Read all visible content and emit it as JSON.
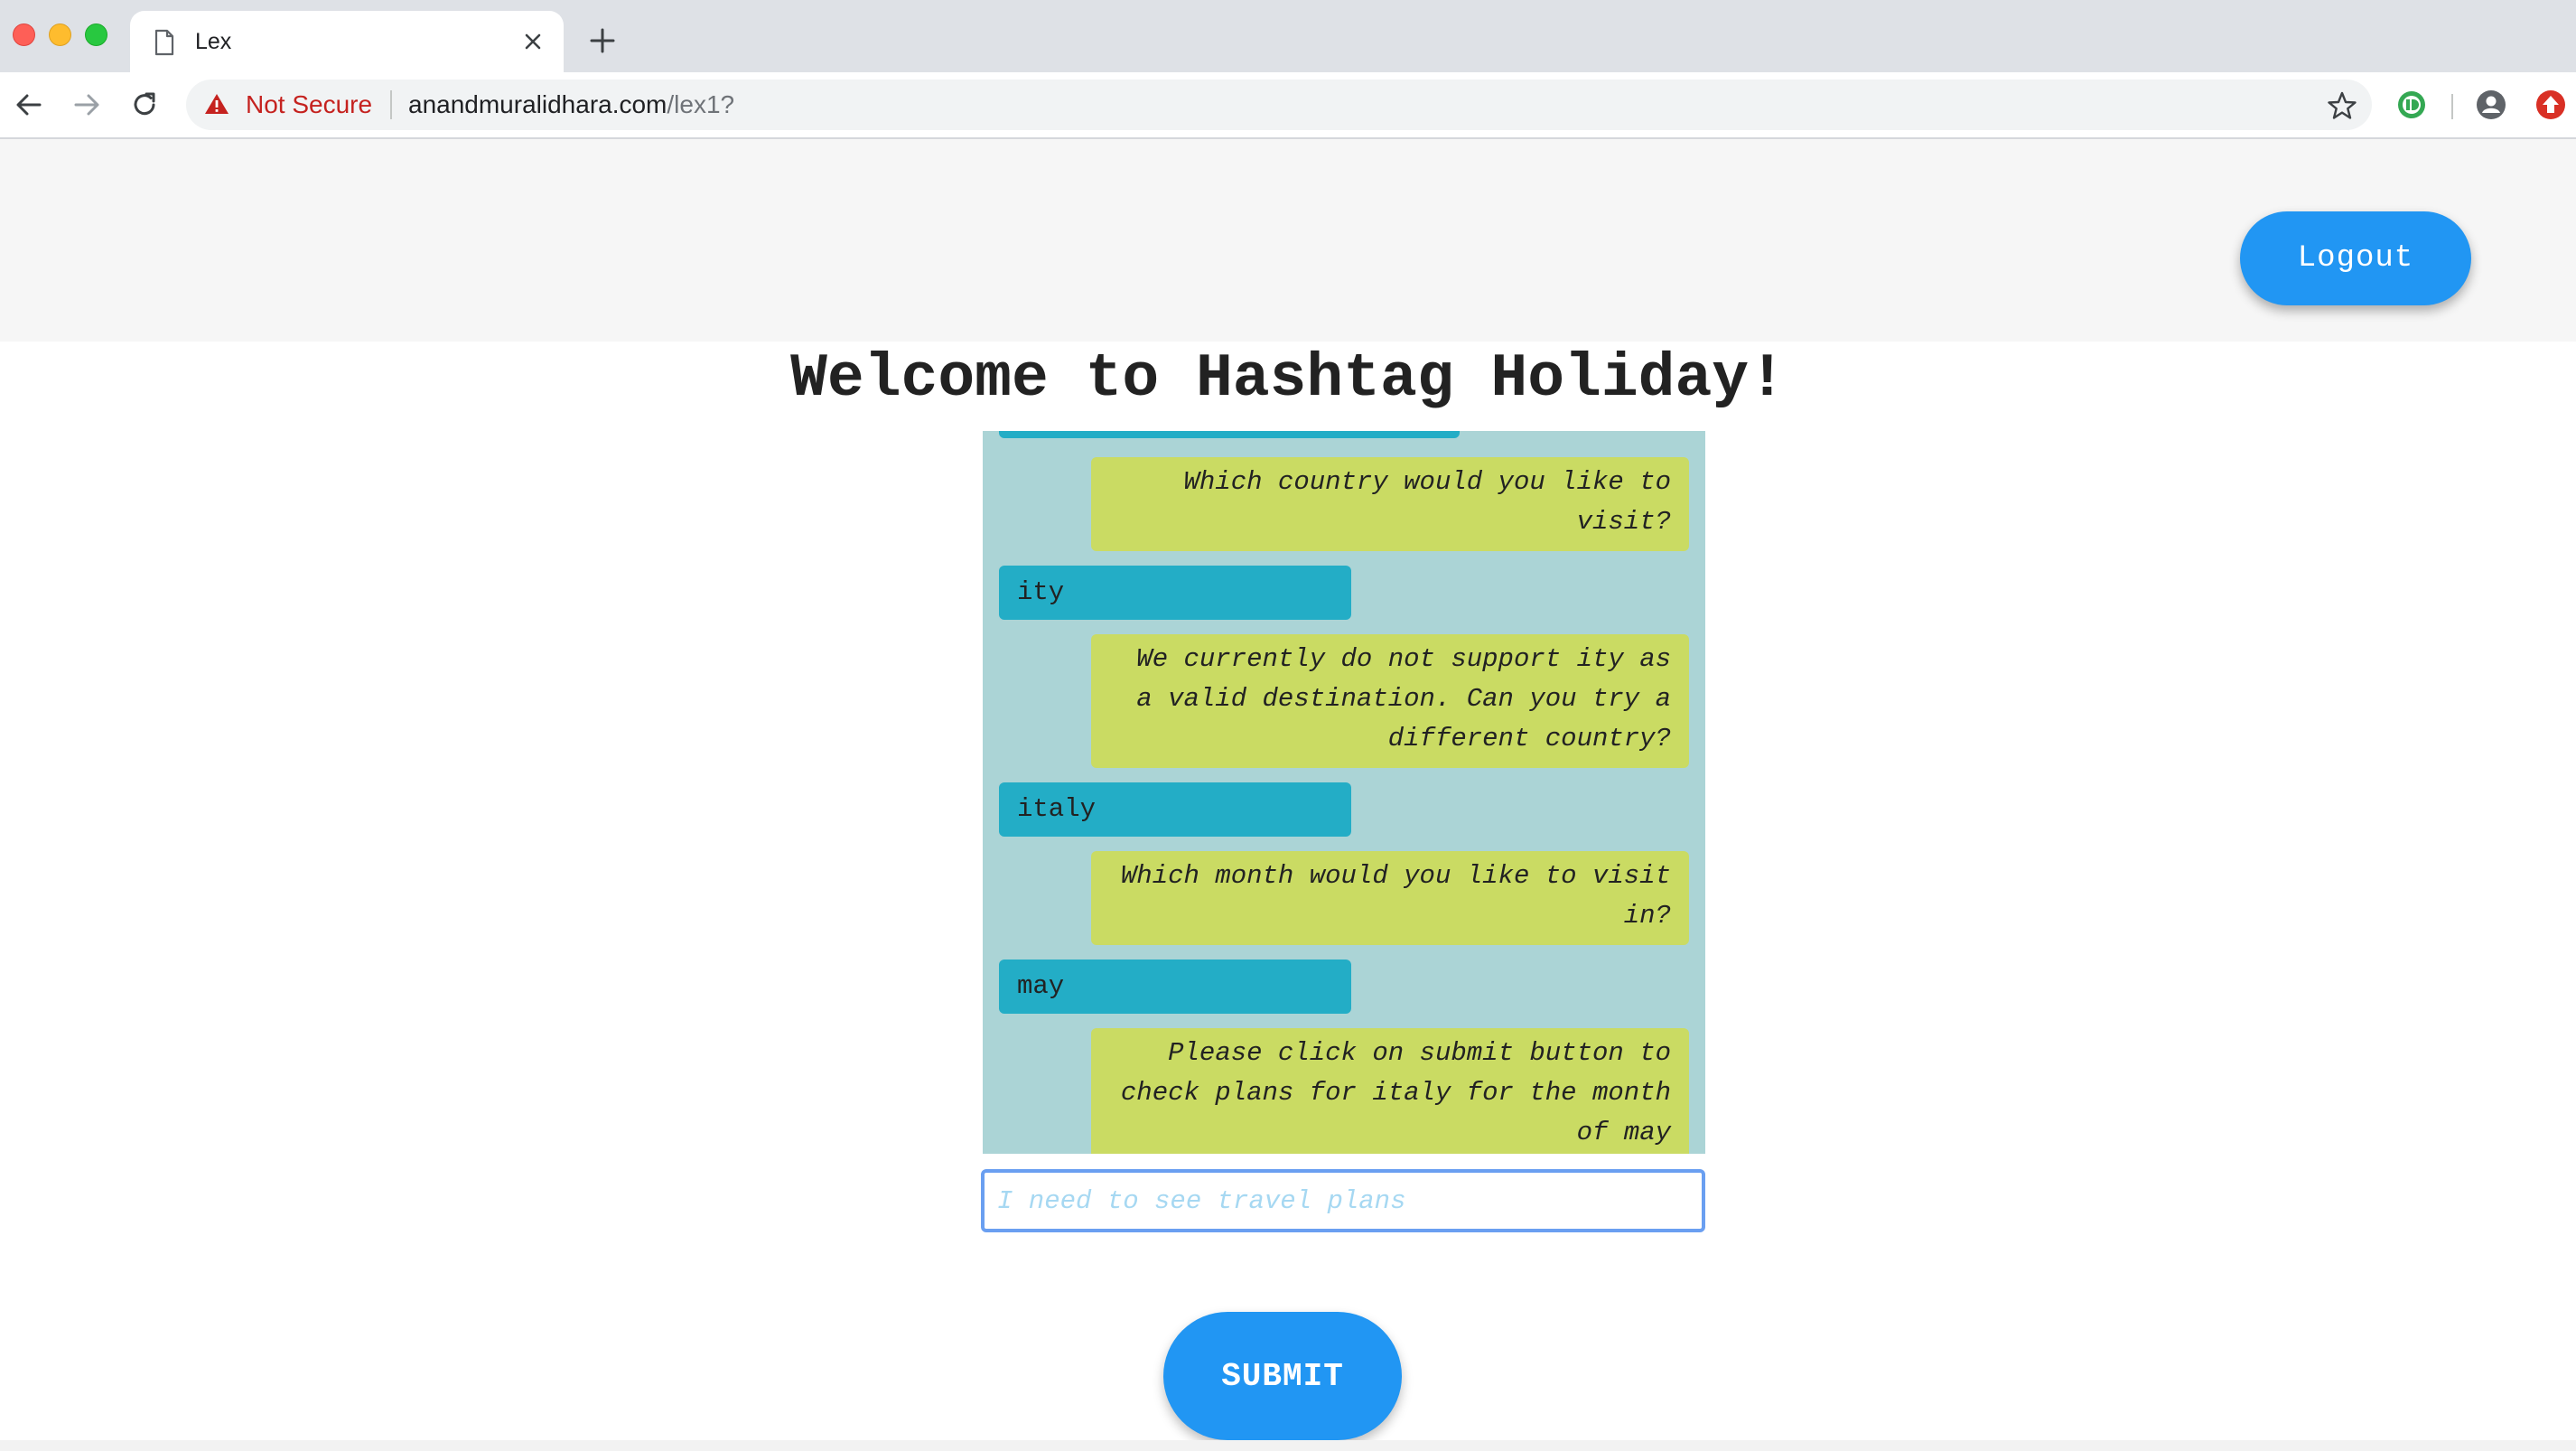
{
  "browser": {
    "tab_title": "Lex",
    "security_label": "Not Secure",
    "url_host": "anandmuralidhara.com",
    "url_path": "/lex1?"
  },
  "header": {
    "logout_label": "Logout"
  },
  "main": {
    "title": "Welcome to Hashtag Holiday!",
    "messages": [
      {
        "sender": "user",
        "text": ""
      },
      {
        "sender": "bot",
        "text": "Which country would you like to visit?"
      },
      {
        "sender": "user",
        "text": "ity"
      },
      {
        "sender": "bot",
        "text": "We currently do not support ity as a valid destination. Can you try a different country?"
      },
      {
        "sender": "user",
        "text": "italy"
      },
      {
        "sender": "bot",
        "text": "Which month would you like to visit in?"
      },
      {
        "sender": "user",
        "text": "may"
      },
      {
        "sender": "bot",
        "text": "Please click on submit button to check plans for italy for the month of may"
      }
    ],
    "input_placeholder": "I need to see travel plans",
    "input_value": "",
    "submit_label": "SUBMIT"
  },
  "icons": {
    "tab": "document-icon",
    "close": "close-icon",
    "new_tab": "plus-icon",
    "back": "back-arrow-icon",
    "forward": "forward-arrow-icon",
    "reload": "reload-icon",
    "warning": "warning-icon",
    "bookmark": "star-icon",
    "extension": "extension-icon",
    "profile": "profile-icon",
    "update": "update-icon"
  },
  "colors": {
    "accent": "#2196f3",
    "user_bubble": "#23adc6",
    "bot_bubble": "#cadb63",
    "chat_background": "#abd4d6",
    "warning": "#c5221f"
  }
}
